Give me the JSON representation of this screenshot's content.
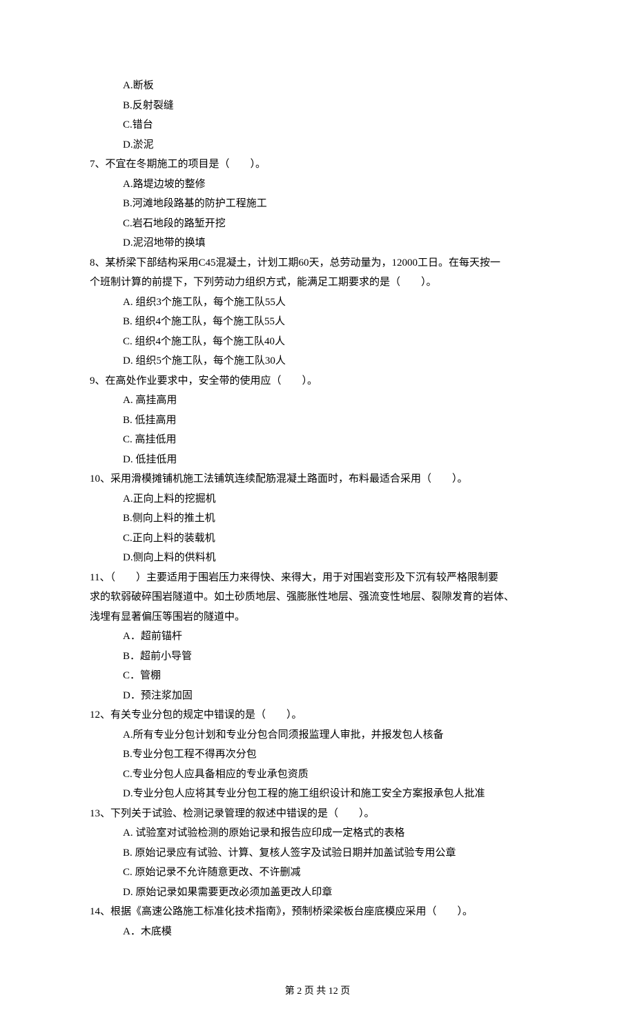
{
  "q6_options": {
    "a": "A.断板",
    "b": "B.反射裂缝",
    "c": "C.错台",
    "d": "D.淤泥"
  },
  "q7": {
    "text": "7、不宜在冬期施工的项目是（　　）。",
    "a": "A.路堤边坡的整修",
    "b": "B.河滩地段路基的防护工程施工",
    "c": "C.岩石地段的路堑开挖",
    "d": "D.泥沼地带的换填"
  },
  "q8": {
    "text1": "8、某桥梁下部结构采用C45混凝土，计划工期60天，总劳动量为，12000工日。在每天按一",
    "text2": "个班制计算的前提下，下列劳动力组织方式，能满足工期要求的是（　　）。",
    "a": "A. 组织3个施工队，每个施工队55人",
    "b": "B. 组织4个施工队，每个施工队55人",
    "c": "C. 组织4个施工队，每个施工队40人",
    "d": "D. 组织5个施工队，每个施工队30人"
  },
  "q9": {
    "text": "9、在高处作业要求中，安全带的使用应（　　）。",
    "a": "A. 高挂高用",
    "b": "B. 低挂高用",
    "c": "C. 高挂低用",
    "d": "D. 低挂低用"
  },
  "q10": {
    "text": "10、采用滑模摊铺机施工法铺筑连续配筋混凝土路面时，布料最适合采用（　　）。",
    "a": "A.正向上料的挖掘机",
    "b": "B.侧向上料的推土机",
    "c": "C.正向上料的装载机",
    "d": "D.侧向上料的供料机"
  },
  "q11": {
    "text1": "11、（　　）主要适用于围岩压力来得快、来得大，用于对围岩变形及下沉有较严格限制要",
    "text2": "求的软弱破碎围岩隧道中。如土砂质地层、强膨胀性地层、强流变性地层、裂隙发育的岩体、",
    "text3": "浅埋有显著偏压等围岩的隧道中。",
    "a": "A．超前锚杆",
    "b": "B．超前小导管",
    "c": "C．管棚",
    "d": "D．预注浆加固"
  },
  "q12": {
    "text": "12、有关专业分包的规定中错误的是（　　）。",
    "a": "A.所有专业分包计划和专业分包合同须报监理人审批，并报发包人核备",
    "b": "B.专业分包工程不得再次分包",
    "c": "C.专业分包人应具备相应的专业承包资质",
    "d": "D.专业分包人应将其专业分包工程的施工组织设计和施工安全方案报承包人批准"
  },
  "q13": {
    "text": "13、下列关于试验、检测记录管理的叙述中错误的是（　　）。",
    "a": "A. 试验室对试验检测的原始记录和报告应印成一定格式的表格",
    "b": "B. 原始记录应有试验、计算、复核人签字及试验日期并加盖试验专用公章",
    "c": "C. 原始记录不允许随意更改、不许删减",
    "d": "D. 原始记录如果需要更改必须加盖更改人印章"
  },
  "q14": {
    "text": "14、根据《高速公路施工标准化技术指南》，预制桥梁梁板台座底模应采用（　　）。",
    "a": "A．木底模"
  },
  "footer": "第 2 页 共 12 页"
}
